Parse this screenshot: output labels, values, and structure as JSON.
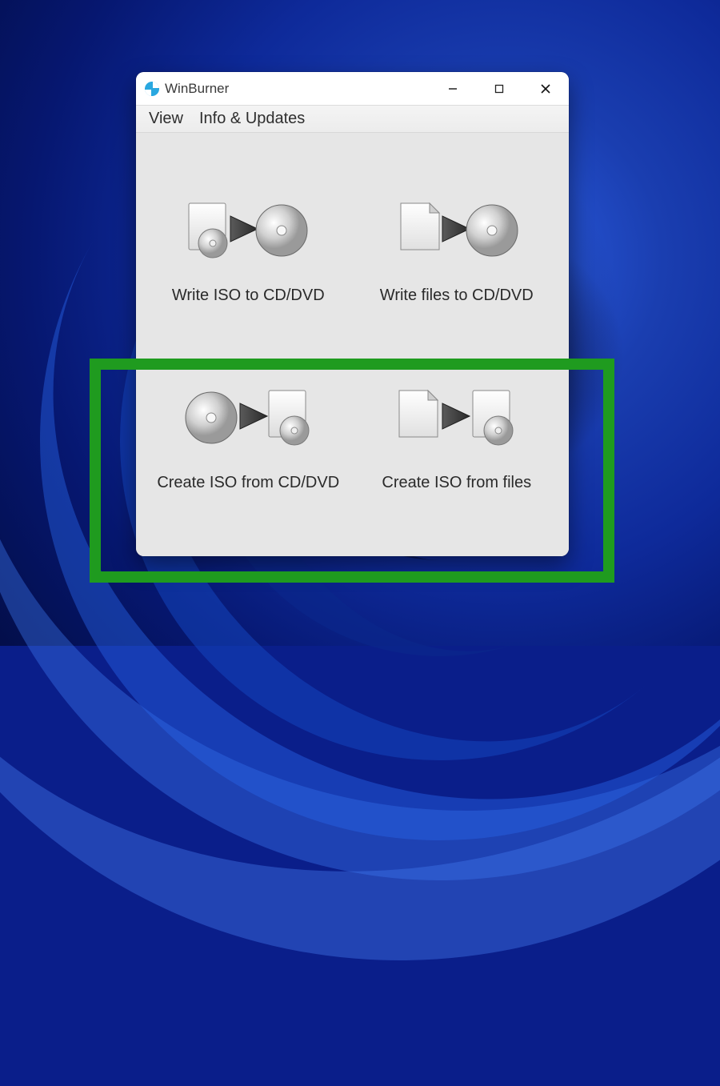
{
  "window": {
    "title": "WinBurner"
  },
  "menu": {
    "view": "View",
    "info": "Info & Updates"
  },
  "actions": {
    "write_iso": "Write ISO to CD/DVD",
    "write_files": "Write files to CD/DVD",
    "create_iso_disc": "Create ISO from CD/DVD",
    "create_iso_files": "Create ISO from files"
  }
}
